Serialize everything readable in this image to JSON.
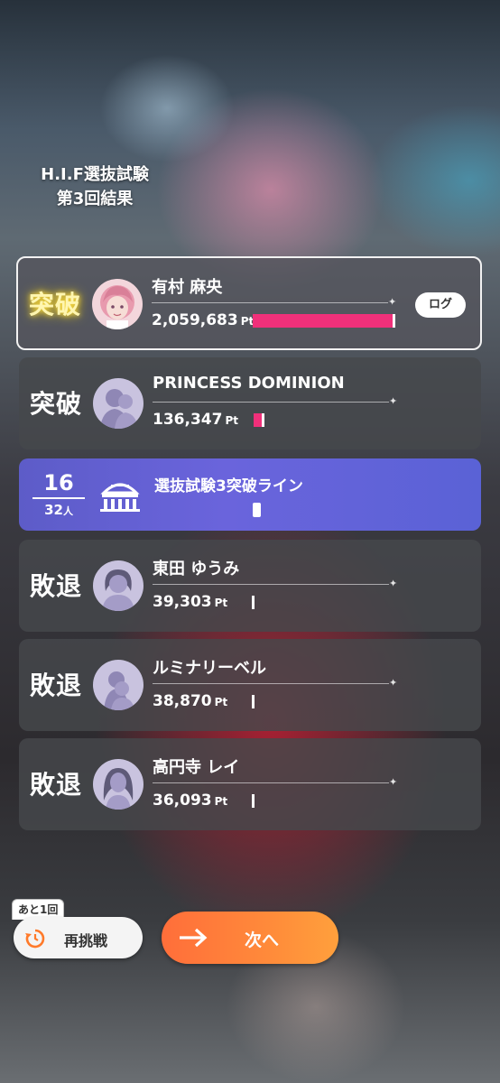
{
  "header": {
    "title_line1": "H.I.F選抜試験",
    "title_line2": "第3回結果"
  },
  "results": [
    {
      "status": "突破",
      "name": "有村 麻央",
      "points": "2,059,683",
      "unit": "Pt",
      "bar_fraction": 0.96,
      "log_label": "ログ",
      "avatar": "mao-avatar"
    },
    {
      "status": "突破",
      "name": "PRINCESS DOMINION",
      "points": "136,347",
      "unit": "Pt",
      "bar_fraction": 0.07,
      "avatar": "silhouette-avatar"
    },
    {
      "status": "敗退",
      "name": "東田 ゆうみ",
      "points": "39,303",
      "unit": "Pt",
      "bar_fraction": 0.02,
      "avatar": "silhouette-avatar"
    },
    {
      "status": "敗退",
      "name": "ルミナリーベル",
      "points": "38,870",
      "unit": "Pt",
      "bar_fraction": 0.02,
      "avatar": "silhouette-avatar"
    },
    {
      "status": "敗退",
      "name": "高円寺 レイ",
      "points": "36,093",
      "unit": "Pt",
      "bar_fraction": 0.02,
      "avatar": "silhouette-avatar"
    }
  ],
  "pass_line": {
    "rank": "16",
    "total": "32",
    "total_unit": "人",
    "title": "選抜試験3突破ライン",
    "icon": "stage-icon"
  },
  "retry": {
    "badge": "あと1回",
    "label": "再挑戦",
    "icon": "retry-timer-icon"
  },
  "next": {
    "label": "次へ",
    "icon": "arrow-right-icon"
  },
  "colors": {
    "bar": "#f0307a",
    "next_button": "#ff8a3a",
    "pass_line": "#6a64dc",
    "breakthrough_gold": "#ffe04a"
  }
}
